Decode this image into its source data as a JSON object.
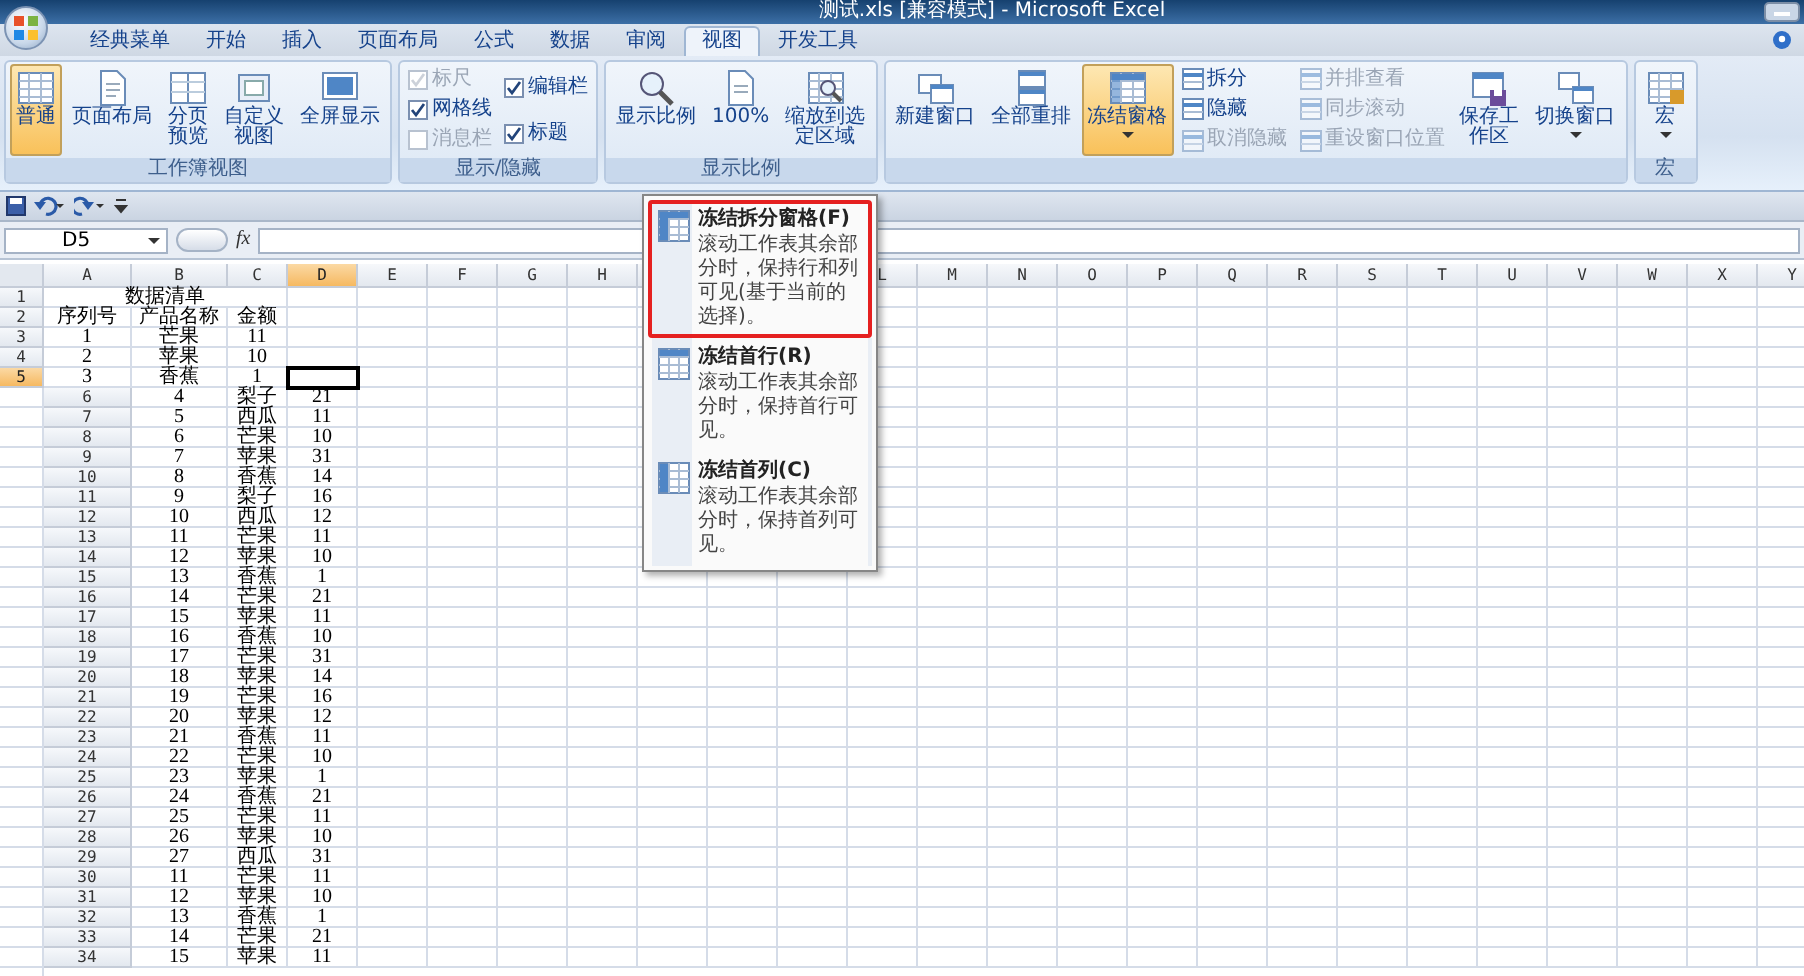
{
  "window": {
    "title": "测试.xls [兼容模式] - Microsoft Excel"
  },
  "tabs": [
    {
      "label": "经典菜单",
      "selected": false
    },
    {
      "label": "开始",
      "selected": false
    },
    {
      "label": "插入",
      "selected": false
    },
    {
      "label": "页面布局",
      "selected": false
    },
    {
      "label": "公式",
      "selected": false
    },
    {
      "label": "数据",
      "selected": false
    },
    {
      "label": "审阅",
      "selected": false
    },
    {
      "label": "视图",
      "selected": true
    },
    {
      "label": "开发工具",
      "selected": false
    }
  ],
  "ribbon_groups": [
    {
      "label": "工作簿视图",
      "controls": [
        {
          "kind": "large",
          "label": "普通",
          "selected": true,
          "menu": false,
          "wrap": false
        },
        {
          "kind": "large",
          "label": "页面布局",
          "selected": false,
          "menu": false,
          "wrap": false
        },
        {
          "kind": "large",
          "label": "分页预览",
          "selected": false,
          "menu": false,
          "wrap": true
        },
        {
          "kind": "large",
          "label": "自定义视图",
          "selected": false,
          "menu": false,
          "wrap": true
        },
        {
          "kind": "large",
          "label": "全屏显示",
          "selected": false,
          "menu": false,
          "wrap": false
        }
      ]
    },
    {
      "label": "显示/隐藏",
      "controls": [
        {
          "kind": "stack",
          "items": [
            {
              "kind": "check",
              "label": "标尺",
              "checked": true,
              "disabled": true
            },
            {
              "kind": "check",
              "label": "网格线",
              "checked": true,
              "disabled": false
            },
            {
              "kind": "check",
              "label": "消息栏",
              "checked": false,
              "disabled": true
            }
          ]
        },
        {
          "kind": "stack",
          "items": [
            {
              "kind": "check",
              "label": "编辑栏",
              "checked": true,
              "disabled": false
            },
            {
              "kind": "check",
              "label": "标题",
              "checked": true,
              "disabled": false
            }
          ]
        }
      ]
    },
    {
      "label": "显示比例",
      "controls": [
        {
          "kind": "large",
          "label": "显示比例",
          "selected": false,
          "menu": false,
          "wrap": false
        },
        {
          "kind": "large",
          "label": "100%",
          "selected": false,
          "menu": false,
          "wrap": false
        },
        {
          "kind": "large",
          "label": "缩放到选定区域",
          "selected": false,
          "menu": false,
          "wrap": true
        }
      ]
    },
    {
      "controls": [
        {
          "kind": "large",
          "label": "新建窗口",
          "selected": false,
          "menu": false,
          "wrap": false
        },
        {
          "kind": "large",
          "label": "全部重排",
          "selected": false,
          "menu": false,
          "wrap": false
        },
        {
          "kind": "large",
          "label": "冻结窗格",
          "selected": true,
          "menu": true,
          "wrap": false
        },
        {
          "kind": "stack",
          "items": [
            {
              "kind": "small",
              "label": "拆分",
              "disabled": false
            },
            {
              "kind": "small",
              "label": "隐藏",
              "disabled": false
            },
            {
              "kind": "small",
              "label": "取消隐藏",
              "disabled": true
            }
          ]
        },
        {
          "kind": "stack",
          "items": [
            {
              "kind": "small",
              "label": "并排查看",
              "disabled": true
            },
            {
              "kind": "small",
              "label": "同步滚动",
              "disabled": true
            },
            {
              "kind": "small",
              "label": "重设窗口位置",
              "disabled": true
            }
          ]
        },
        {
          "kind": "large",
          "label": "保存工作区",
          "selected": false,
          "menu": false,
          "wrap": true
        },
        {
          "kind": "large",
          "label": "切换窗口",
          "selected": false,
          "menu": true,
          "wrap": false
        }
      ]
    },
    {
      "label": "宏",
      "controls": [
        {
          "kind": "large",
          "label": "宏",
          "selected": false,
          "menu": true,
          "wrap": false
        }
      ]
    }
  ],
  "formula_bar": {
    "name_box": "D5",
    "function_label": "fx"
  },
  "dropdown": {
    "items": [
      {
        "title": "冻结拆分窗格(F)",
        "description": "滚动工作表其余部分时，保持行和列可见(基于当前的选择)。",
        "highlighted": true
      },
      {
        "title": "冻结首行(R)",
        "description": "滚动工作表其余部分时，保持首行可见。",
        "highlighted": false
      },
      {
        "title": "冻结首列(C)",
        "description": "滚动工作表其余部分时，保持首列可见。",
        "highlighted": false
      }
    ]
  },
  "columns": [
    {
      "label": "A",
      "selected": false
    },
    {
      "label": "B",
      "selected": false
    },
    {
      "label": "C",
      "selected": false
    },
    {
      "label": "D",
      "selected": true
    },
    {
      "label": "E",
      "selected": false
    },
    {
      "label": "F",
      "selected": false
    },
    {
      "label": "G",
      "selected": false
    },
    {
      "label": "H",
      "selected": false
    },
    {
      "selected": false
    },
    {},
    {},
    {
      "label": "L",
      "selected": false
    },
    {
      "label": "M",
      "selected": false
    },
    {
      "label": "N",
      "selected": false
    },
    {
      "label": "O",
      "selected": false
    },
    {
      "label": "P",
      "selected": false
    },
    {
      "label": "Q",
      "selected": false
    },
    {
      "label": "R",
      "selected": false
    },
    {
      "label": "S",
      "selected": false
    },
    {
      "label": "T",
      "selected": false
    },
    {
      "label": "U",
      "selected": false
    },
    {
      "label": "V",
      "selected": false
    },
    {
      "label": "W",
      "selected": false
    },
    {
      "label": "X",
      "selected": false
    },
    {
      "label": "Y",
      "selected": false
    }
  ],
  "rows": [
    {
      "header": "1",
      "selected": false,
      "title": "数据清单"
    },
    {
      "header": "2",
      "selected": false,
      "cells": [
        "序列号",
        "产品名称",
        "金额"
      ]
    },
    {
      "header": "3",
      "selected": false,
      "cells": [
        "1",
        "芒果",
        "11"
      ]
    },
    {
      "header": "4",
      "selected": false,
      "cells": [
        "2",
        "苹果",
        "10"
      ]
    },
    {
      "header": "5",
      "selected": true,
      "cells": [
        "3",
        "香蕉",
        "1"
      ]
    },
    {
      "header": "6",
      "selected": false,
      "cells": [
        "4",
        "梨子",
        "21"
      ]
    },
    {
      "header": "7",
      "selected": false,
      "cells": [
        "5",
        "西瓜",
        "11"
      ]
    },
    {
      "header": "8",
      "selected": false,
      "cells": [
        "6",
        "芒果",
        "10"
      ]
    },
    {
      "header": "9",
      "selected": false,
      "cells": [
        "7",
        "苹果",
        "31"
      ]
    },
    {
      "header": "10",
      "selected": false,
      "cells": [
        "8",
        "香蕉",
        "14"
      ]
    },
    {
      "header": "11",
      "selected": false,
      "cells": [
        "9",
        "梨子",
        "16"
      ]
    },
    {
      "header": "12",
      "selected": false,
      "cells": [
        "10",
        "西瓜",
        "12"
      ]
    },
    {
      "header": "13",
      "selected": false,
      "cells": [
        "11",
        "芒果",
        "11"
      ]
    },
    {
      "header": "14",
      "selected": false,
      "cells": [
        "12",
        "苹果",
        "10"
      ]
    },
    {
      "header": "15",
      "selected": false,
      "cells": [
        "13",
        "香蕉",
        "1"
      ]
    },
    {
      "header": "16",
      "selected": false,
      "cells": [
        "14",
        "芒果",
        "21"
      ]
    },
    {
      "header": "17",
      "selected": false,
      "cells": [
        "15",
        "苹果",
        "11"
      ]
    },
    {
      "header": "18",
      "selected": false,
      "cells": [
        "16",
        "香蕉",
        "10"
      ]
    },
    {
      "header": "19",
      "selected": false,
      "cells": [
        "17",
        "芒果",
        "31"
      ]
    },
    {
      "header": "20",
      "selected": false,
      "cells": [
        "18",
        "苹果",
        "14"
      ]
    },
    {
      "header": "21",
      "selected": false,
      "cells": [
        "19",
        "芒果",
        "16"
      ]
    },
    {
      "header": "22",
      "selected": false,
      "cells": [
        "20",
        "苹果",
        "12"
      ]
    },
    {
      "header": "23",
      "selected": false,
      "cells": [
        "21",
        "香蕉",
        "11"
      ]
    },
    {
      "header": "24",
      "selected": false,
      "cells": [
        "22",
        "芒果",
        "10"
      ]
    },
    {
      "header": "25",
      "selected": false,
      "cells": [
        "23",
        "苹果",
        "1"
      ]
    },
    {
      "header": "26",
      "selected": false,
      "cells": [
        "24",
        "香蕉",
        "21"
      ]
    },
    {
      "header": "27",
      "selected": false,
      "cells": [
        "25",
        "芒果",
        "11"
      ]
    },
    {
      "header": "28",
      "selected": false,
      "cells": [
        "26",
        "苹果",
        "10"
      ]
    },
    {
      "header": "29",
      "selected": false,
      "cells": [
        "27",
        "西瓜",
        "31"
      ]
    },
    {
      "header": "30",
      "selected": false,
      "cells": [
        "11",
        "芒果",
        "11"
      ]
    },
    {
      "header": "31",
      "selected": false,
      "cells": [
        "12",
        "苹果",
        "10"
      ]
    },
    {
      "header": "32",
      "selected": false,
      "cells": [
        "13",
        "香蕉",
        "1"
      ]
    },
    {
      "header": "33",
      "selected": false,
      "cells": [
        "14",
        "芒果",
        "21"
      ]
    },
    {
      "header": "34",
      "selected": false,
      "cells": [
        "15",
        "苹果",
        "11"
      ]
    }
  ]
}
